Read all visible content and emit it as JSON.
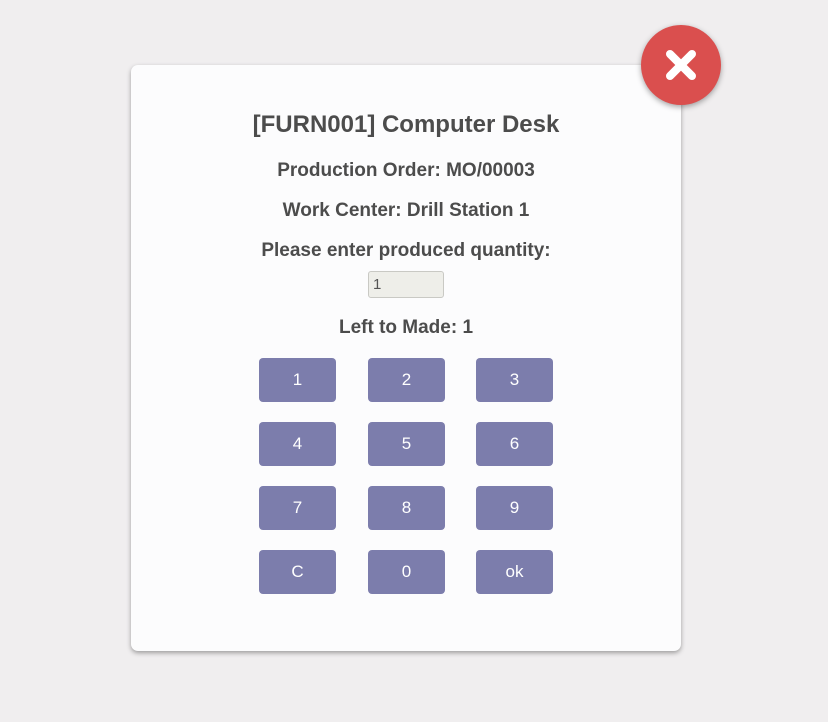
{
  "dialog": {
    "title": "[FURN001] Computer Desk",
    "production_order": "Production Order: MO/00003",
    "work_center": "Work Center: Drill Station 1",
    "prompt": "Please enter produced quantity:",
    "quantity_value": "1",
    "left_to_make": "Left to Made: 1"
  },
  "keypad": {
    "keys": [
      "1",
      "2",
      "3",
      "4",
      "5",
      "6",
      "7",
      "8",
      "9",
      "C",
      "0",
      "ok"
    ]
  },
  "colors": {
    "background": "#f0eeef",
    "dialog_bg": "#fcfcfd",
    "key_bg": "#7c7dac",
    "close_bg": "#da4f4e",
    "text": "#4c4c4c"
  },
  "icons": {
    "close": "close-icon"
  }
}
